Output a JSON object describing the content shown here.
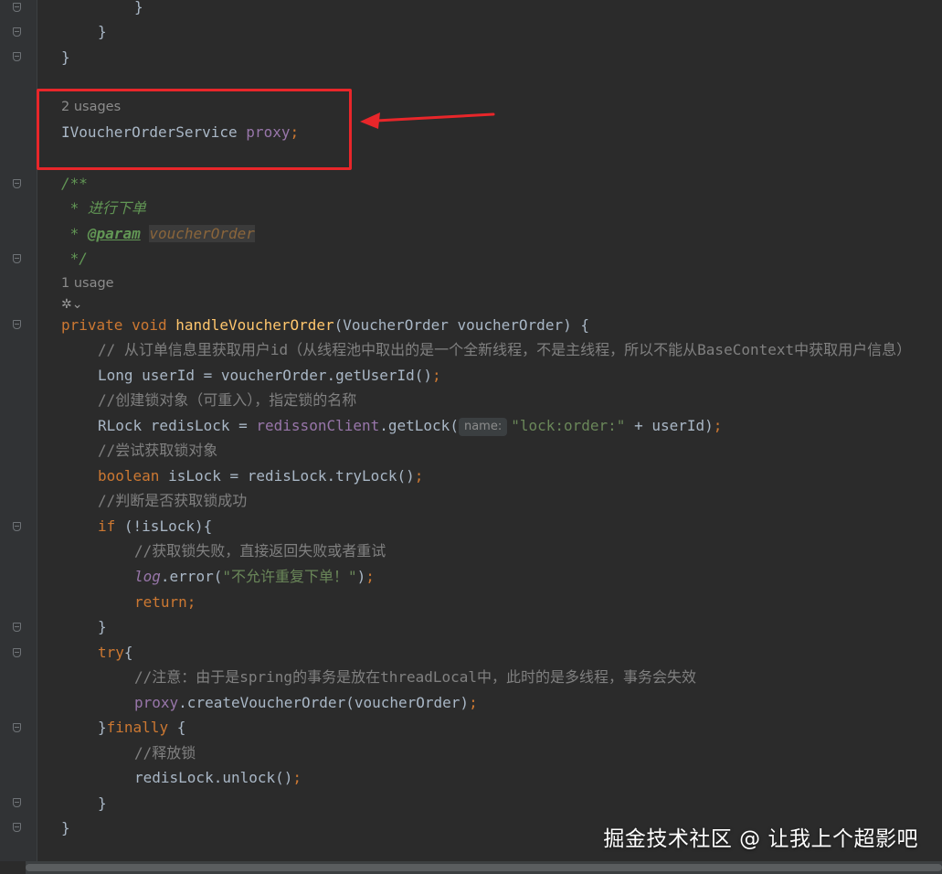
{
  "editor": {
    "lines": {
      "l1": "}",
      "l2": "}",
      "l3": "}",
      "usages2": "2 usages",
      "field_type": "IVoucherOrderService ",
      "field_name": "proxy",
      "field_semi": ";",
      "doc_open": "/**",
      "doc_desc": " * 进行下单",
      "doc_star": " * ",
      "doc_param_tag": "@param",
      "doc_param_name": "voucherOrder",
      "doc_close": " */",
      "usages1": "1 usage",
      "sig_private": "private ",
      "sig_void": "void ",
      "sig_name": "handleVoucherOrder",
      "sig_rest": "(VoucherOrder voucherOrder) {",
      "c1": "// 从订单信息里获取用户id（从线程池中取出的是一个全新线程，不是主线程，所以不能从BaseContext中获取用户信息）",
      "l_userid": "Long userId = voucherOrder.getUserId()",
      "semi": ";",
      "c2": "//创建锁对象（可重入），指定锁的名称",
      "l_rlock_a": "RLock redisLock = ",
      "l_rlock_field": "redissonClient",
      "l_rlock_b": ".getLock(",
      "hint_name": "name:",
      "l_rlock_str": "\"lock:order:\"",
      "l_rlock_c": " + userId)",
      "c3": "//尝试获取锁对象",
      "kw_boolean": "boolean ",
      "l_bool_rest": "isLock = redisLock.tryLock()",
      "c4": "//判断是否获取锁成功",
      "kw_if": "if ",
      "l_if_rest": "(!isLock){",
      "c5": "//获取锁失败，直接返回失败或者重试",
      "log": "log",
      "log_rest": ".error(",
      "log_str": "\"不允许重复下单！\"",
      "log_close": ")",
      "kw_return": "return",
      "close_brace": "}",
      "kw_try": "try",
      "open_brace": "{",
      "c6": "//注意：由于是spring的事务是放在threadLocal中，此时的是多线程，事务会失效",
      "proxy": "proxy",
      "proxy_rest": ".createVoucherOrder(voucherOrder)",
      "close_brace2": "}",
      "kw_finally": "finally ",
      "open_brace2": "{",
      "c7": "//释放锁",
      "unlock": "redisLock.unlock()",
      "close_brace3": "}",
      "close_brace4": "}"
    },
    "ai_icon": "ai-assistant-icon",
    "watermark": "掘金技术社区 @ 让我上个超影吧"
  },
  "colors": {
    "background": "#2b2b2b",
    "keyword": "#cc7832",
    "function": "#ffc66d",
    "field": "#9876aa",
    "string": "#6a8759",
    "comment": "#808080",
    "annotation_box": "#e8262a"
  }
}
